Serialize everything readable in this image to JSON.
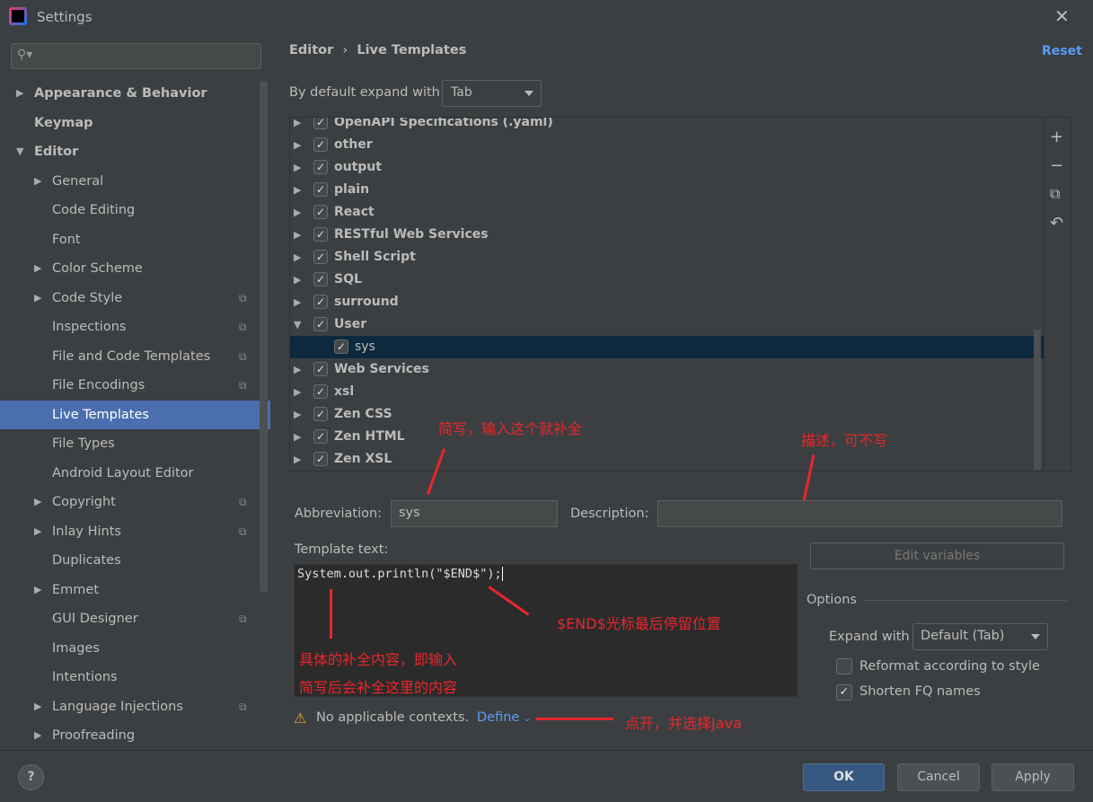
{
  "window": {
    "title": "Settings"
  },
  "search": {
    "placeholder": ""
  },
  "sidebar": {
    "items": [
      {
        "label": "Appearance & Behavior",
        "arrow": "▶",
        "bold": true,
        "indent": 0
      },
      {
        "label": "Keymap",
        "arrow": "",
        "bold": true,
        "indent": 0
      },
      {
        "label": "Editor",
        "arrow": "▼",
        "bold": true,
        "indent": 0
      },
      {
        "label": "General",
        "arrow": "▶",
        "indent": 1
      },
      {
        "label": "Code Editing",
        "arrow": "",
        "indent": 1
      },
      {
        "label": "Font",
        "arrow": "",
        "indent": 1
      },
      {
        "label": "Color Scheme",
        "arrow": "▶",
        "indent": 1
      },
      {
        "label": "Code Style",
        "arrow": "▶",
        "indent": 1,
        "copy": true
      },
      {
        "label": "Inspections",
        "arrow": "",
        "indent": 1,
        "copy": true
      },
      {
        "label": "File and Code Templates",
        "arrow": "",
        "indent": 1,
        "copy": true
      },
      {
        "label": "File Encodings",
        "arrow": "",
        "indent": 1,
        "copy": true
      },
      {
        "label": "Live Templates",
        "arrow": "",
        "indent": 1,
        "selected": true
      },
      {
        "label": "File Types",
        "arrow": "",
        "indent": 1
      },
      {
        "label": "Android Layout Editor",
        "arrow": "",
        "indent": 1
      },
      {
        "label": "Copyright",
        "arrow": "▶",
        "indent": 1,
        "copy": true
      },
      {
        "label": "Inlay Hints",
        "arrow": "▶",
        "indent": 1,
        "copy": true
      },
      {
        "label": "Duplicates",
        "arrow": "",
        "indent": 1
      },
      {
        "label": "Emmet",
        "arrow": "▶",
        "indent": 1
      },
      {
        "label": "GUI Designer",
        "arrow": "",
        "indent": 1,
        "copy": true
      },
      {
        "label": "Images",
        "arrow": "",
        "indent": 1
      },
      {
        "label": "Intentions",
        "arrow": "",
        "indent": 1
      },
      {
        "label": "Language Injections",
        "arrow": "▶",
        "indent": 1,
        "copy": true
      },
      {
        "label": "Proofreading",
        "arrow": "▶",
        "indent": 1
      }
    ]
  },
  "header": {
    "breadcrumb_parent": "Editor",
    "breadcrumb_sep": "›",
    "breadcrumb_current": "Live Templates",
    "reset": "Reset"
  },
  "expand": {
    "label": "By default expand with",
    "value": "Tab"
  },
  "tree": {
    "rows": [
      {
        "label": "OpenAPI Specifications (.yaml)",
        "arrow": "▶",
        "checked": true
      },
      {
        "label": "other",
        "arrow": "▶",
        "checked": true
      },
      {
        "label": "output",
        "arrow": "▶",
        "checked": true
      },
      {
        "label": "plain",
        "arrow": "▶",
        "checked": true
      },
      {
        "label": "React",
        "arrow": "▶",
        "checked": true
      },
      {
        "label": "RESTful Web Services",
        "arrow": "▶",
        "checked": true
      },
      {
        "label": "Shell Script",
        "arrow": "▶",
        "checked": true
      },
      {
        "label": "SQL",
        "arrow": "▶",
        "checked": true
      },
      {
        "label": "surround",
        "arrow": "▶",
        "checked": true
      },
      {
        "label": "User",
        "arrow": "▼",
        "checked": true
      },
      {
        "label": "sys",
        "arrow": "",
        "checked": true,
        "child": true,
        "selected": true
      },
      {
        "label": "Web Services",
        "arrow": "▶",
        "checked": true
      },
      {
        "label": "xsl",
        "arrow": "▶",
        "checked": true
      },
      {
        "label": "Zen CSS",
        "arrow": "▶",
        "checked": true
      },
      {
        "label": "Zen HTML",
        "arrow": "▶",
        "checked": true
      },
      {
        "label": "Zen XSL",
        "arrow": "▶",
        "checked": true
      }
    ],
    "tools": [
      "+",
      "−",
      "⧉",
      "↶"
    ]
  },
  "form": {
    "abbreviation_label": "Abbreviation:",
    "abbreviation_value": "sys",
    "description_label": "Description:",
    "description_value": "",
    "template_label": "Template text:",
    "template_value": "System.out.println(\"$END$\");",
    "edit_variables": "Edit variables",
    "options_label": "Options",
    "expand_with_label": "Expand with",
    "expand_with_value": "Default (Tab)",
    "reformat_label": "Reformat according to style",
    "reformat_checked": false,
    "shorten_label": "Shorten FQ names",
    "shorten_checked": true,
    "warning": "No applicable contexts.",
    "define": "Define"
  },
  "annotations": {
    "abbr": "简写，输入这个就补全",
    "desc": "描述，可不写",
    "end": "$END$光标最后停留位置",
    "content1": "具体的补全内容，即输入",
    "content2": "简写后会补全这里的内容",
    "define": "点开，并选择Java"
  },
  "footer": {
    "help": "?",
    "ok": "OK",
    "cancel": "Cancel",
    "apply": "Apply"
  },
  "colors": {
    "accent": "#4b6eaf",
    "link": "#589df6",
    "annotation": "#e8262b"
  }
}
